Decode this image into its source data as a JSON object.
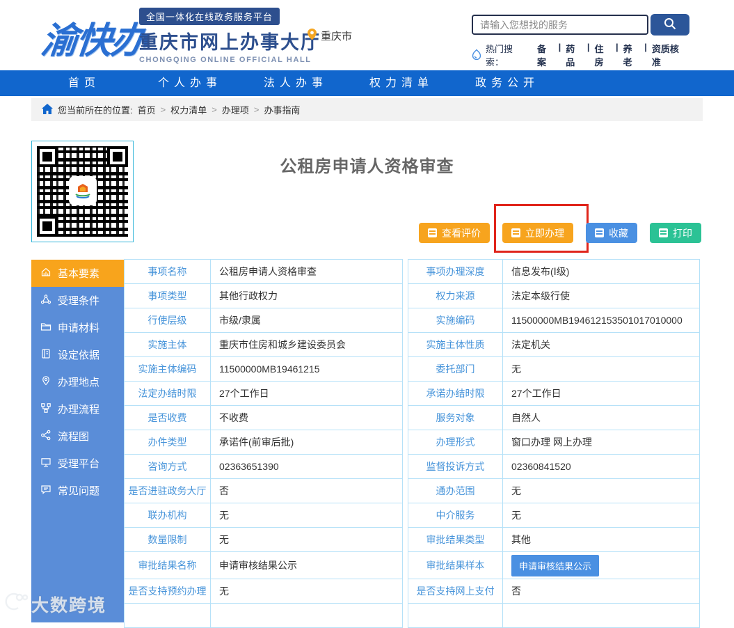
{
  "header": {
    "logo_text": "渝快办",
    "badge": "全国一体化在线政务服务平台",
    "site_name": "重庆市网上办事大厅",
    "site_name_en": "CHONGQING ONLINE OFFICIAL HALL",
    "location": "重庆市",
    "search": {
      "placeholder": "请输入您想找的服务"
    },
    "hot_search": {
      "label": "热门搜索：",
      "items": [
        "备案",
        "药品",
        "住房",
        "养老",
        "资质核准"
      ]
    }
  },
  "nav": {
    "items": [
      "首页",
      "个人办事",
      "法人办事",
      "权力清单",
      "政务公开"
    ]
  },
  "breadcrumb": {
    "prefix": "您当前所在的位置:",
    "items": [
      "首页",
      "权力清单",
      "办理项",
      "办事指南"
    ]
  },
  "page": {
    "title": "公租房申请人资格审查"
  },
  "actions": [
    {
      "label": "查看评价",
      "color": "#f7a41e",
      "icon": "doc-icon",
      "highlighted": false
    },
    {
      "label": "立即办理",
      "color": "#f7a41e",
      "icon": "doc-icon",
      "highlighted": true
    },
    {
      "label": "收藏",
      "color": "#4a90e2",
      "icon": "doc-icon",
      "highlighted": false
    },
    {
      "label": "打印",
      "color": "#2bc295",
      "icon": "doc-icon",
      "highlighted": false
    }
  ],
  "sidebar": {
    "items": [
      {
        "label": "基本要素",
        "icon": "building-icon",
        "active": true
      },
      {
        "label": "受理条件",
        "icon": "org-icon",
        "active": false
      },
      {
        "label": "申请材料",
        "icon": "folder-icon",
        "active": false
      },
      {
        "label": "设定依据",
        "icon": "book-icon",
        "active": false
      },
      {
        "label": "办理地点",
        "icon": "location-icon",
        "active": false
      },
      {
        "label": "办理流程",
        "icon": "workflow-icon",
        "active": false
      },
      {
        "label": "流程图",
        "icon": "share-icon",
        "active": false
      },
      {
        "label": "受理平台",
        "icon": "platform-icon",
        "active": false
      },
      {
        "label": "常见问题",
        "icon": "faq-icon",
        "active": false
      }
    ]
  },
  "details": {
    "rows": [
      {
        "l1": "事项名称",
        "v1": "公租房申请人资格审查",
        "l2": "事项办理深度",
        "v2": "信息发布(Ⅰ级)",
        "v2_button": false
      },
      {
        "l1": "事项类型",
        "v1": "其他行政权力",
        "l2": "权力来源",
        "v2": "法定本级行使",
        "v2_button": false
      },
      {
        "l1": "行使层级",
        "v1": "市级/隶属",
        "l2": "实施编码",
        "v2": "11500000MB194612153501017010000",
        "v2_button": false
      },
      {
        "l1": "实施主体",
        "v1": "重庆市住房和城乡建设委员会",
        "l2": "实施主体性质",
        "v2": "法定机关",
        "v2_button": false
      },
      {
        "l1": "实施主体编码",
        "v1": "11500000MB19461215",
        "l2": "委托部门",
        "v2": "无",
        "v2_button": false
      },
      {
        "l1": "法定办结时限",
        "v1": "27个工作日",
        "l2": "承诺办结时限",
        "v2": "27个工作日",
        "v2_button": false
      },
      {
        "l1": "是否收费",
        "v1": "不收费",
        "l2": "服务对象",
        "v2": "自然人",
        "v2_button": false
      },
      {
        "l1": "办件类型",
        "v1": "承诺件(前审后批)",
        "l2": "办理形式",
        "v2": "窗口办理 网上办理",
        "v2_button": false
      },
      {
        "l1": "咨询方式",
        "v1": "02363651390",
        "l2": "监督投诉方式",
        "v2": "02360841520",
        "v2_button": false
      },
      {
        "l1": "是否进驻政务大厅",
        "v1": "否",
        "l2": "通办范围",
        "v2": "无",
        "v2_button": false
      },
      {
        "l1": "联办机构",
        "v1": "无",
        "l2": "中介服务",
        "v2": "无",
        "v2_button": false
      },
      {
        "l1": "数量限制",
        "v1": "无",
        "l2": "审批结果类型",
        "v2": "其他",
        "v2_button": false
      },
      {
        "l1": "审批结果名称",
        "v1": "申请审核结果公示",
        "l2": "审批结果样本",
        "v2": "申请审核结果公示",
        "v2_button": true
      },
      {
        "l1": "是否支持预约办理",
        "v1": "无",
        "l2": "是否支持网上支付",
        "v2": "否",
        "v2_button": false
      }
    ]
  },
  "watermark": {
    "text": "大数跨境"
  },
  "colors": {
    "brand_navy": "#2d4f8e",
    "nav_blue": "#1166cd",
    "sidebar_blue": "#5a8dd8",
    "active_orange": "#f8a41c",
    "action_orange": "#f7a41e",
    "favorite_blue": "#4a90e2",
    "print_green": "#2bc295",
    "highlight_red": "#e0251b",
    "table_border": "#b5e1f8",
    "label_blue": "#4794da"
  }
}
